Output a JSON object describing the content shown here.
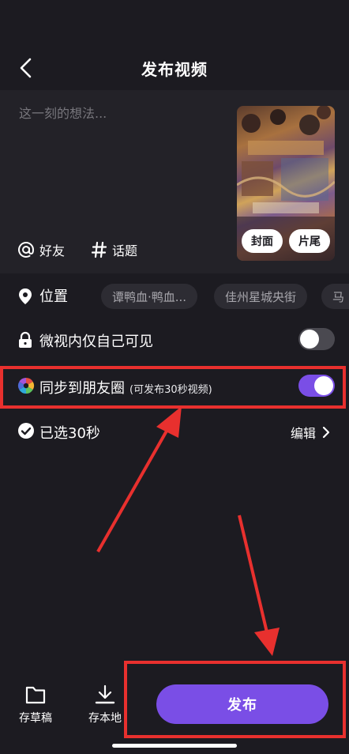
{
  "header": {
    "title": "发布视频"
  },
  "compose": {
    "placeholder": "这一刻的想法...",
    "friends_label": "好友",
    "topic_label": "话题",
    "cover_label": "封面",
    "ending_label": "片尾"
  },
  "location": {
    "label": "位置",
    "chips": [
      "谭鸭血·鸭血...",
      "佳州星城央街",
      "马"
    ]
  },
  "privacy": {
    "label": "微视内仅自己可见",
    "enabled": false
  },
  "sync": {
    "label": "同步到朋友圈",
    "sub": "(可发布30秒视频)",
    "enabled": true
  },
  "selected": {
    "label": "已选30秒",
    "edit_label": "编辑"
  },
  "footer": {
    "draft_label": "存草稿",
    "save_local_label": "存本地",
    "publish_label": "发布"
  },
  "colors": {
    "accent": "#7a4ee6",
    "annotation": "#e8302e",
    "background": "#1c1b21"
  },
  "icons": [
    "back-icon",
    "at-icon",
    "hash-icon",
    "location-pin-icon",
    "lock-icon",
    "wechat-moments-icon",
    "check-circle-icon",
    "chevron-right-icon",
    "folder-icon",
    "download-icon"
  ]
}
